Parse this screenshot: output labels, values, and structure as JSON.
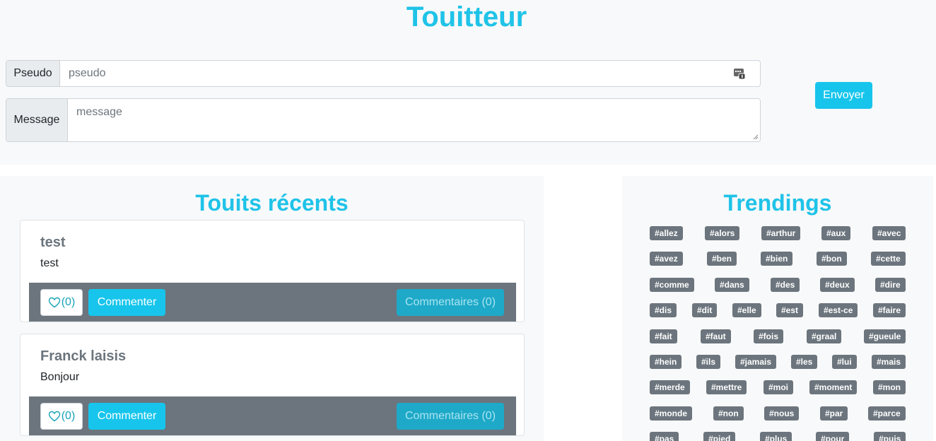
{
  "app": {
    "title": "Touitteur"
  },
  "form": {
    "pseudo_label": "Pseudo",
    "pseudo_placeholder": "pseudo",
    "message_label": "Message",
    "message_placeholder": "message",
    "send_label": "Envoyer"
  },
  "recent": {
    "title": "Touits récents",
    "touits": [
      {
        "author": "test",
        "message": "test",
        "likes": "(0)",
        "comment_label": "Commenter",
        "comments_label": "Commentaires (0)"
      },
      {
        "author": "Franck laisis",
        "message": "Bonjour",
        "likes": "(0)",
        "comment_label": "Commenter",
        "comments_label": "Commentaires (0)"
      }
    ]
  },
  "trendings": {
    "title": "Trendings",
    "tags": [
      "#allez",
      "#alors",
      "#arthur",
      "#aux",
      "#avec",
      "#avez",
      "#ben",
      "#bien",
      "#bon",
      "#cette",
      "#comme",
      "#dans",
      "#des",
      "#deux",
      "#dire",
      "#dis",
      "#dit",
      "#elle",
      "#est",
      "#est-ce",
      "#faire",
      "#fait",
      "#faut",
      "#fois",
      "#graal",
      "#gueule",
      "#hein",
      "#ils",
      "#jamais",
      "#les",
      "#lui",
      "#mais",
      "#merde",
      "#mettre",
      "#moi",
      "#moment",
      "#mon",
      "#monde",
      "#non",
      "#nous",
      "#par",
      "#parce",
      "#pas",
      "#pied",
      "#plus",
      "#pour",
      "#puis"
    ]
  },
  "colors": {
    "accent": "#1fc3e8",
    "badge": "#6c757d",
    "panel": "#f8f9fa"
  }
}
